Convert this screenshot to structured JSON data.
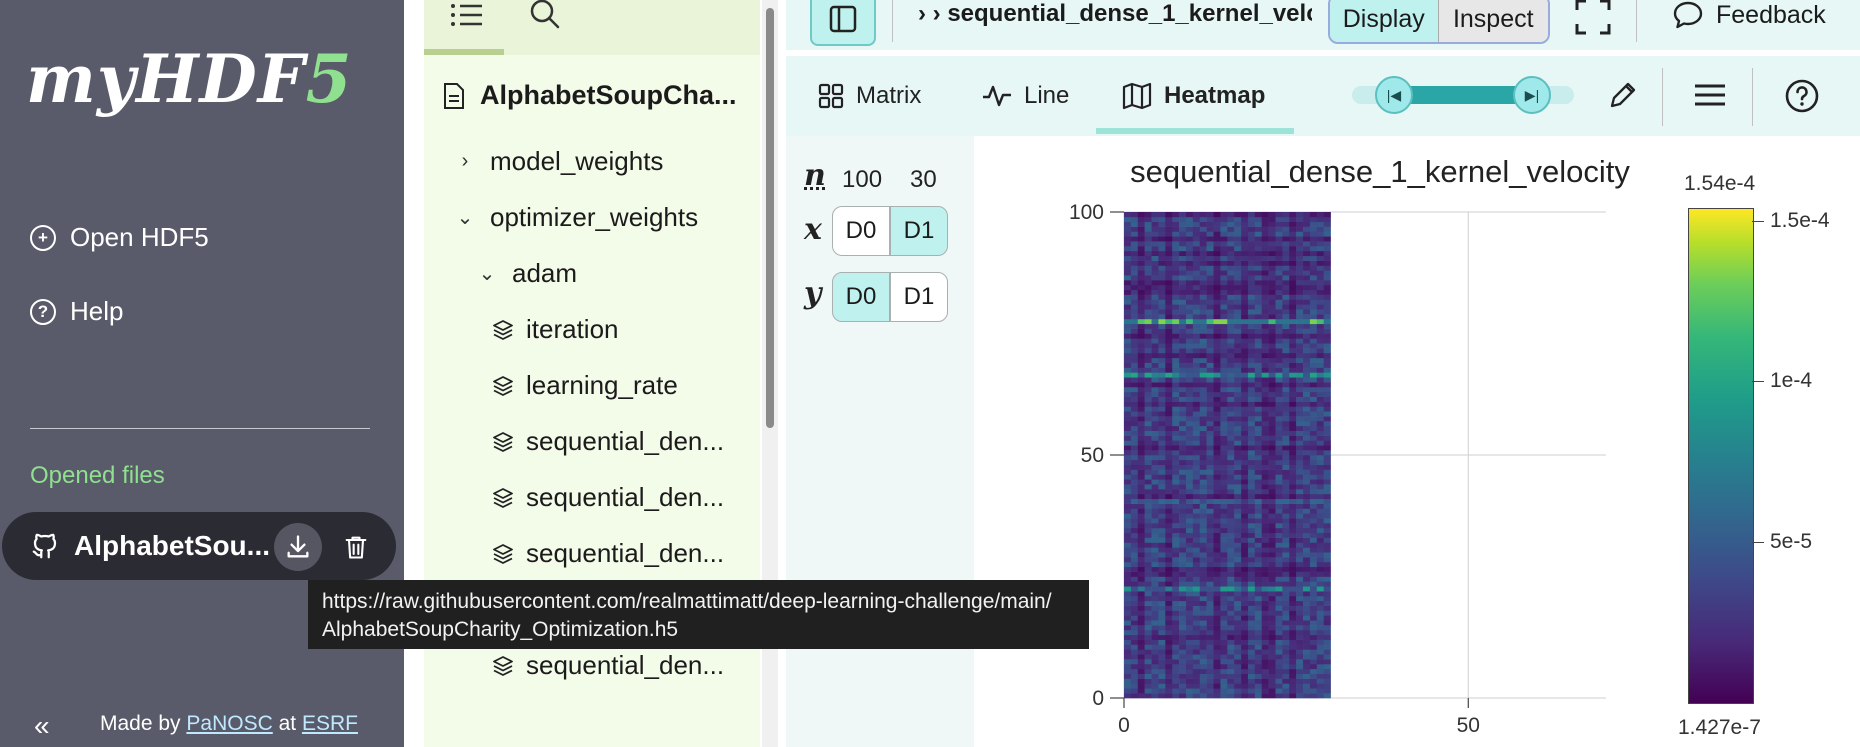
{
  "app": {
    "logo_main": "myHDF",
    "logo_accent": "5"
  },
  "sidebar": {
    "open_label": "Open HDF5",
    "help_label": "Help",
    "opened_heading": "Opened files",
    "file_name": "AlphabetSou...",
    "made_by_prefix": "Made by",
    "made_by_org1": "PaNOSC",
    "made_by_mid": "at",
    "made_by_org2": "ESRF",
    "collapse_glyph": "«"
  },
  "tooltip": {
    "line1": "https://raw.githubusercontent.com/realmattimatt/deep-learning-challenge/main/",
    "line2": "AlphabetSoupCharity_Optimization.h5"
  },
  "explorer": {
    "file_root": "AlphabetSoupCha...",
    "items": [
      {
        "label": "model_weights",
        "kind": "group-collapsed"
      },
      {
        "label": "optimizer_weights",
        "kind": "group-expanded"
      },
      {
        "label": "adam",
        "kind": "group-expanded"
      },
      {
        "label": "iteration",
        "kind": "dataset"
      },
      {
        "label": "learning_rate",
        "kind": "dataset"
      },
      {
        "label": "sequential_den...",
        "kind": "dataset"
      },
      {
        "label": "sequential_den...",
        "kind": "dataset"
      },
      {
        "label": "sequential_den...",
        "kind": "dataset"
      },
      {
        "label": "sequential_den...",
        "kind": "dataset"
      },
      {
        "label": "sequential_den...",
        "kind": "dataset"
      }
    ]
  },
  "header": {
    "breadcrumb": "› › sequential_dense_1_kernel_velocity",
    "mode_display": "Display",
    "mode_inspect": "Inspect",
    "feedback": "Feedback"
  },
  "vis_tabs": {
    "matrix": "Matrix",
    "line": "Line",
    "heatmap": "Heatmap",
    "active": "heatmap"
  },
  "dim_mapper": {
    "n_label": "n",
    "x_label": "x",
    "y_label": "y",
    "dim0_size": "100",
    "dim1_size": "30",
    "d0": "D0",
    "d1": "D1",
    "x_selected": "D1",
    "y_selected": "D0"
  },
  "chart_data": {
    "type": "heatmap",
    "title": "sequential_dense_1_kernel_velocity",
    "x_dim": 30,
    "y_dim": 100,
    "xlim": [
      0,
      70
    ],
    "ylim": [
      0,
      100
    ],
    "x_ticks": [
      "0",
      "50"
    ],
    "y_ticks": [
      "0",
      "50",
      "100"
    ],
    "colormap": "viridis",
    "colorbar_min": "1.427e-7",
    "colorbar_max": "1.54e-4",
    "colorbar_ticks": [
      {
        "value": 5e-05,
        "label": "5e-5"
      },
      {
        "value": 0.0001,
        "label": "1e-4"
      },
      {
        "value": 0.00015,
        "label": "1.5e-4"
      }
    ],
    "grid": true,
    "bright_rows": [
      {
        "row": 77,
        "level": 0.85
      },
      {
        "row": 66,
        "level": 0.6
      },
      {
        "row": 22,
        "level": 0.55
      },
      {
        "row": 40,
        "level": 0.35
      }
    ]
  },
  "colors": {
    "sidebar_bg": "#5a5b6a",
    "accent_green": "#8fe08f",
    "teal_accent": "#bff2ef"
  },
  "icons": {
    "open": "plus-circle-icon",
    "help": "question-circle-icon",
    "file": "github-icon",
    "download": "download-icon",
    "delete": "trash-icon"
  }
}
